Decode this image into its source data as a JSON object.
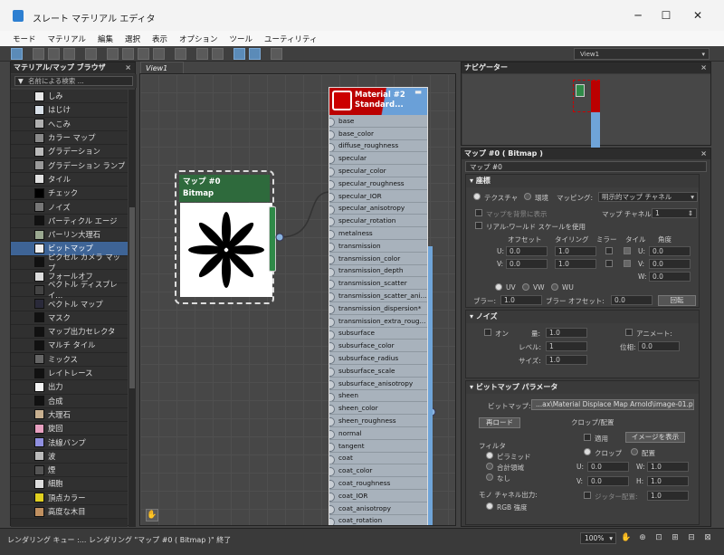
{
  "window": {
    "title": "スレート マテリアル エディタ",
    "minimize": "─",
    "maximize": "☐",
    "close": "✕"
  },
  "menu": [
    "モード",
    "マテリアル",
    "編集",
    "選択",
    "表示",
    "オプション",
    "ツール",
    "ユーティリティ"
  ],
  "view_selector": "View1",
  "browser": {
    "title": "マテリアル/マップ ブラウザ",
    "search_placeholder": "名前による検索 ...",
    "items": [
      {
        "label": "しみ",
        "color": "#e8e8e8"
      },
      {
        "label": "はじけ",
        "color": "#d8e0e8"
      },
      {
        "label": "へこみ",
        "color": "#b0b0b0"
      },
      {
        "label": "カラー マップ",
        "color": "#8a8a8a"
      },
      {
        "label": "グラデーション",
        "color": "#bbbbbb"
      },
      {
        "label": "グラデーション ランプ",
        "color": "#999999"
      },
      {
        "label": "タイル",
        "color": "#e0e0e0"
      },
      {
        "label": "チェック",
        "color": "#000000"
      },
      {
        "label": "ノイズ",
        "color": "#777777"
      },
      {
        "label": "パーティクル エージ",
        "color": "#111111"
      },
      {
        "label": "パーリン大理石",
        "color": "#9aa890"
      },
      {
        "label": "ビットマップ",
        "color": "#eeeeee"
      },
      {
        "label": "ピクセル カメラ マップ",
        "color": "#111111"
      },
      {
        "label": "フォールオフ",
        "color": "#dddddd"
      },
      {
        "label": "ベクトル ディスプレイ...",
        "color": "#444444"
      },
      {
        "label": "ベクトル マップ",
        "color": "#2a2a3a"
      },
      {
        "label": "マスク",
        "color": "#111111"
      },
      {
        "label": "マップ出力セレクタ",
        "color": "#111111"
      },
      {
        "label": "マルチ タイル",
        "color": "#111111"
      },
      {
        "label": "ミックス",
        "color": "#666666"
      },
      {
        "label": "レイトレース",
        "color": "#111111"
      },
      {
        "label": "出力",
        "color": "#f5f5f5"
      },
      {
        "label": "合成",
        "color": "#111111"
      },
      {
        "label": "大理石",
        "color": "#c8b090"
      },
      {
        "label": "旋回",
        "color": "#e8a0c0"
      },
      {
        "label": "法線バンプ",
        "color": "#9090e0"
      },
      {
        "label": "波",
        "color": "#bbbbbb"
      },
      {
        "label": "煙",
        "color": "#555555"
      },
      {
        "label": "細胞",
        "color": "#dddddd"
      },
      {
        "label": "頂点カラー",
        "color": "#e0d020"
      },
      {
        "label": "高度な木目",
        "color": "#c09060"
      }
    ],
    "selected_index": 11
  },
  "view_tab": "View1",
  "map_node": {
    "title": "マップ #0",
    "subtitle": "Bitmap"
  },
  "material_node": {
    "title": "Material #2",
    "subtitle": "Standard...",
    "slots": [
      "base",
      "base_color",
      "diffuse_roughness",
      "specular",
      "specular_color",
      "specular_roughness",
      "specular_IOR",
      "specular_anisotropy",
      "specular_rotation",
      "metalness",
      "transmission",
      "transmission_color",
      "transmission_depth",
      "transmission_scatter",
      "transmission_scatter_ani...",
      "transmission_dispersion*",
      "transmission_extra_roug...",
      "subsurface",
      "subsurface_color",
      "subsurface_radius",
      "subsurface_scale",
      "subsurface_anisotropy",
      "sheen",
      "sheen_color",
      "sheen_roughness",
      "normal",
      "tangent",
      "coat",
      "coat_color",
      "coat_roughness",
      "coat_IOR",
      "coat_anisotropy",
      "coat_rotation"
    ]
  },
  "navigator": {
    "title": "ナビゲーター"
  },
  "props": {
    "title": "マップ #0 ( Bitmap )",
    "name_field": "マップ #0",
    "coords": {
      "title": "座標",
      "texture": "テクスチャ",
      "environ": "環境",
      "mapping_label": "マッピング:",
      "mapping_value": "明示的マップ チャネル",
      "show_bg": "マップを背景に表示",
      "map_channel_label": "マップ チャネル:",
      "map_channel_value": "1",
      "realworld": "リアル-ワールド スケールを使用",
      "offset": "オフセット",
      "tiling": "タイリング",
      "mirror": "ミラー",
      "tile": "タイル",
      "angle": "角度",
      "u_offset": "0.0",
      "v_offset": "0.0",
      "u_tiling": "1.0",
      "v_tiling": "1.0",
      "u_angle": "0.0",
      "v_angle": "0.0",
      "w_angle": "0.0",
      "uv": "UV",
      "vw": "VW",
      "wu": "WU",
      "blur_label": "ブラー:",
      "blur_value": "1.0",
      "blur_offset_label": "ブラー オフセット:",
      "blur_offset_value": "0.0",
      "rotate": "回転"
    },
    "noise": {
      "title": "ノイズ",
      "on": "オン",
      "amount_label": "量:",
      "amount_value": "1.0",
      "levels_label": "レベル:",
      "levels_value": "1",
      "size_label": "サイズ:",
      "size_value": "1.0",
      "animate": "アニメート:",
      "phase_label": "位相:",
      "phase_value": "0.0"
    },
    "bitmap": {
      "title": "ビットマップ パラメータ",
      "bitmap_label": "ビットマップ:",
      "bitmap_path": "...ax\\Material Displace Map Arnold\\image-01.png",
      "reload": "再ロード",
      "crop_title": "クロップ/配置",
      "apply": "適用",
      "view_image": "イメージを表示",
      "crop": "クロップ",
      "place": "配置",
      "filter_title": "フィルタ",
      "pyramid": "ピラミッド",
      "summed": "合計領域",
      "none": "なし",
      "u_label": "U:",
      "u_value": "0.0",
      "v_label": "V:",
      "v_value": "0.0",
      "w_label": "W:",
      "w_value": "1.0",
      "h_label": "H:",
      "h_value": "1.0",
      "jitter": "ジッター配置:",
      "jitter_value": "1.0",
      "mono_title": "モノ チャネル出力:",
      "rgb": "RGB 強度"
    }
  },
  "status": {
    "text": "レンダリング キュー :... レンダリング \"マップ #0 ( Bitmap )\" 終了",
    "zoom": "100%"
  }
}
